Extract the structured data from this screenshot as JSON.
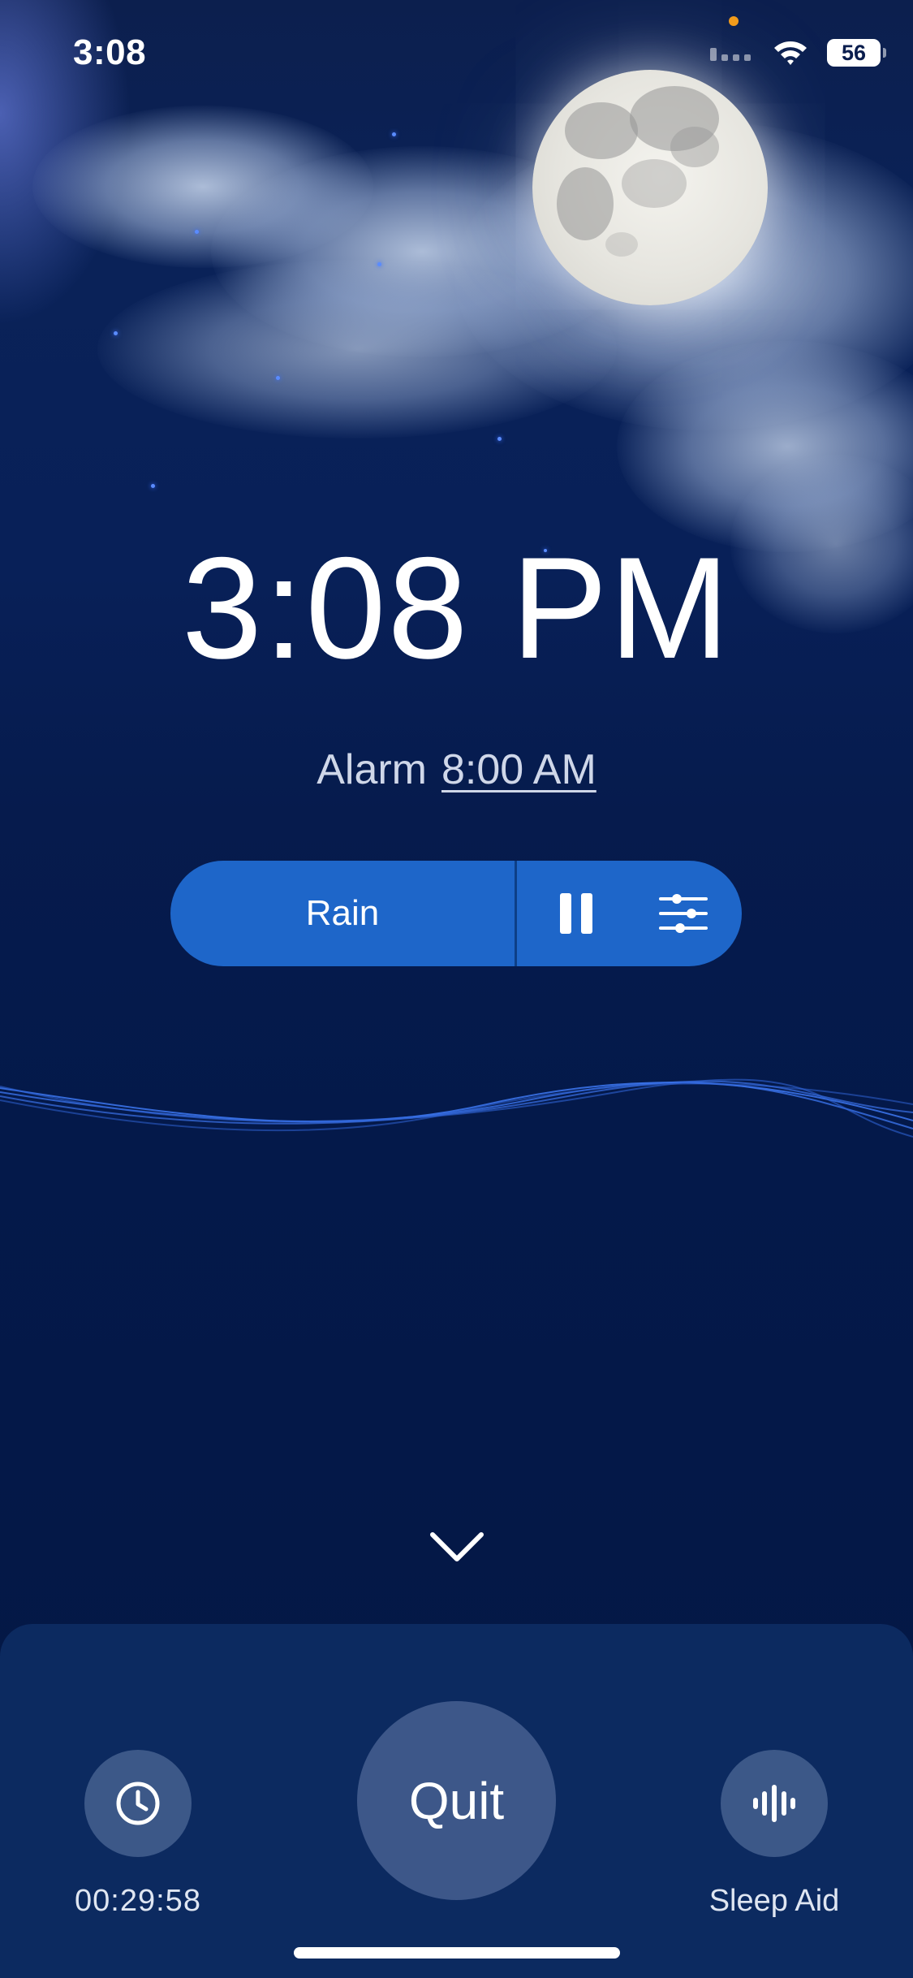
{
  "status_bar": {
    "time": "3:08",
    "battery_level": "56",
    "icons": [
      "signal-icon",
      "wifi-icon",
      "battery-icon"
    ]
  },
  "clock": {
    "time": "3:08 PM"
  },
  "alarm": {
    "label": "Alarm",
    "time": "8:00 AM"
  },
  "sound": {
    "name": "Rain",
    "state_icon": "pause-icon",
    "settings_icon": "sliders-icon"
  },
  "bottom": {
    "timer_value": "00:29:58",
    "quit_label": "Quit",
    "sleep_aid_label": "Sleep Aid"
  },
  "colors": {
    "background": "#04194a",
    "pill": "#1e66c9",
    "panel": "#0c2a60",
    "wave": "#3a72e8",
    "privacy_dot": "#f29b1b"
  }
}
